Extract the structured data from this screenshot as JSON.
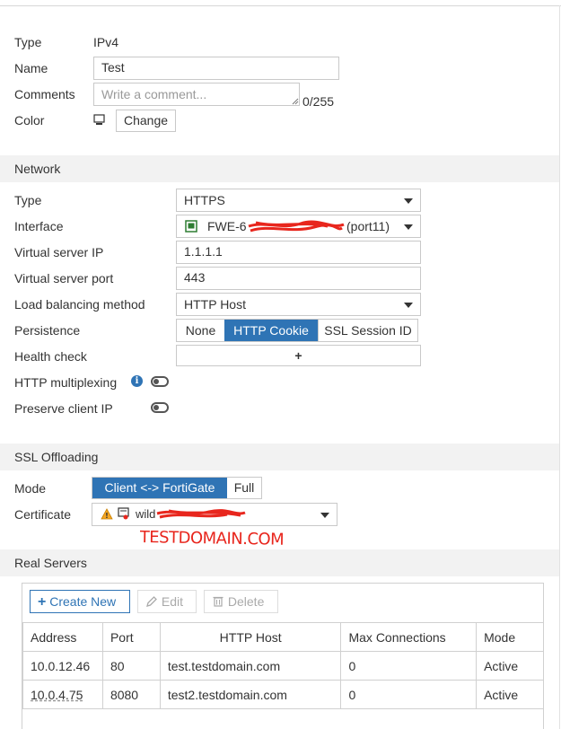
{
  "general": {
    "type_label": "Type",
    "type_value": "IPv4",
    "name_label": "Name",
    "name_value": "Test",
    "comments_label": "Comments",
    "comments_placeholder": "Write a comment...",
    "comments_counter": "0/255",
    "color_label": "Color",
    "change_button": "Change"
  },
  "network": {
    "section_title": "Network",
    "type_label": "Type",
    "type_value": "HTTPS",
    "interface_label": "Interface",
    "interface_value": "FWE-6",
    "interface_port": "(port11)",
    "vip_label": "Virtual server IP",
    "vip_value": "1.1.1.1",
    "vport_label": "Virtual server port",
    "vport_value": "443",
    "lb_label": "Load balancing method",
    "lb_value": "HTTP Host",
    "persistence_label": "Persistence",
    "persistence_options": [
      "None",
      "HTTP Cookie",
      "SSL Session ID"
    ],
    "persistence_selected": "HTTP Cookie",
    "health_label": "Health check",
    "health_add": "+",
    "multiplex_label": "HTTP multiplexing",
    "info_glyph": "i",
    "preserve_label": "Preserve client IP"
  },
  "ssl": {
    "section_title": "SSL Offloading",
    "mode_label": "Mode",
    "mode_options": [
      "Client <-> FortiGate",
      "Full"
    ],
    "mode_selected": "Client <-> FortiGate",
    "cert_label": "Certificate",
    "cert_value": "wild",
    "cert_warning_glyph": "!",
    "handwritten_note": "TESTDOMAIN.COM"
  },
  "real_servers": {
    "section_title": "Real Servers",
    "create_new": "Create New",
    "edit": "Edit",
    "delete": "Delete",
    "columns": [
      "Address",
      "Port",
      "HTTP Host",
      "Max Connections",
      "Mode"
    ],
    "rows": [
      {
        "address": "10.0.12.46",
        "port": "80",
        "host": "test.testdomain.com",
        "max": "0",
        "mode": "Active"
      },
      {
        "address": "10.0.4.75",
        "port": "8080",
        "host": "test2.testdomain.com",
        "max": "0",
        "mode": "Active"
      }
    ]
  },
  "colors": {
    "accent": "#2f74b5",
    "section_bg": "#f2f2f2",
    "redaction": "#e8261d"
  }
}
